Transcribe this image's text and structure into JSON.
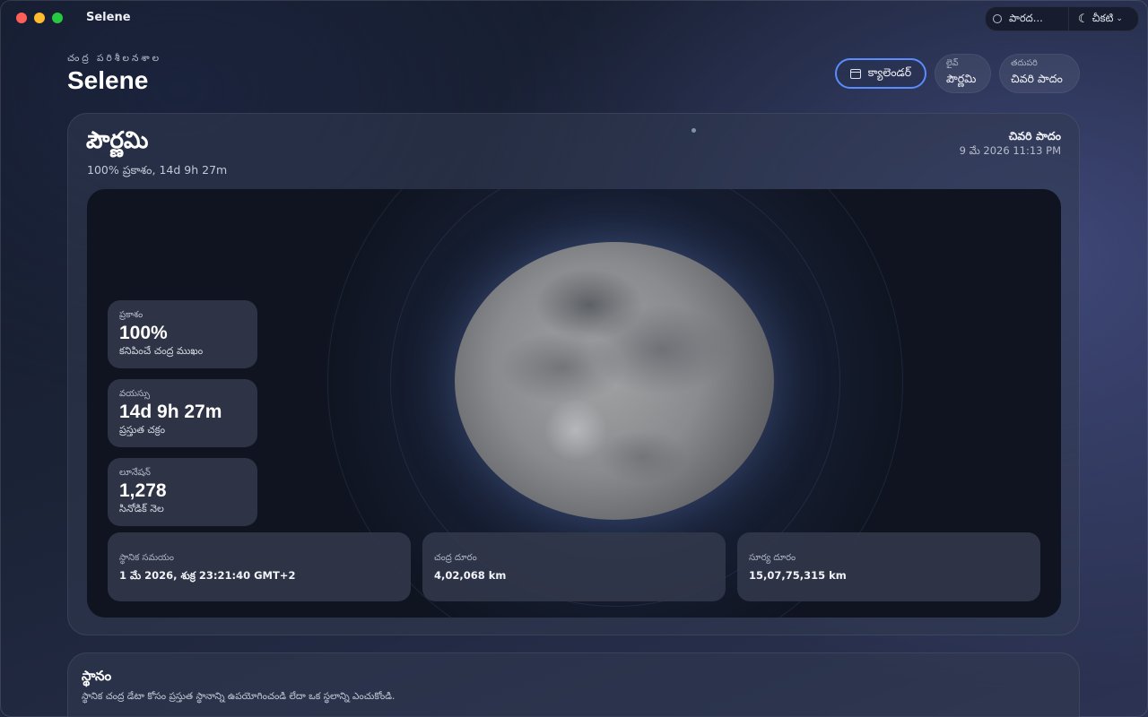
{
  "window": {
    "app_title": "Selene"
  },
  "topbar": {
    "location_label": "పారద...",
    "theme_label": "చీకటి"
  },
  "header": {
    "eyebrow": "చంద్ర పరిశీలనశాల",
    "title": "Selene"
  },
  "nav": {
    "calendar_label": "క్యాలెండర్",
    "live_small": "లైవ్",
    "live_main": "పౌర్ణమి",
    "next_small": "తదుపరి",
    "next_main": "చివరి పాదం"
  },
  "phase": {
    "name": "పౌర్ణమి",
    "subtitle": "100% ప్రకాశం, 14d 9h 27m",
    "next_name": "చివరి పాదం",
    "next_date": "9 మే 2026 11:13 PM"
  },
  "stats": [
    {
      "label": "ప్రకాశం",
      "value": "100%",
      "note": "కనిపించే చంద్ర ముఖం"
    },
    {
      "label": "వయస్సు",
      "value": "14d 9h 27m",
      "note": "ప్రస్తుత చక్రం"
    },
    {
      "label": "లూనేషన్",
      "value": "1,278",
      "note": "సినోడిక్ నెల"
    }
  ],
  "info": [
    {
      "label": "స్థానిక సమయం",
      "value": "1 మే 2026, శుక్ర 23:21:40 GMT+2"
    },
    {
      "label": "చంద్ర దూరం",
      "value": "4,02,068 km"
    },
    {
      "label": "సూర్య దూరం",
      "value": "15,07,75,315 km"
    }
  ],
  "location": {
    "title": "స్థానం",
    "description": "స్థానిక చంద్ర డేటా కోసం ప్రస్తుత స్థానాన్ని ఉపయోగించండి లేదా ఒక స్థలాన్ని ఎంచుకోండి."
  },
  "icons": [
    "radio-icon",
    "moon-icon",
    "chevron-down-icon",
    "calendar-icon"
  ],
  "colors": {
    "accent": "#5b8cff",
    "close": "#fe5f57",
    "minimize": "#febc2e",
    "zoom": "#28c840"
  }
}
